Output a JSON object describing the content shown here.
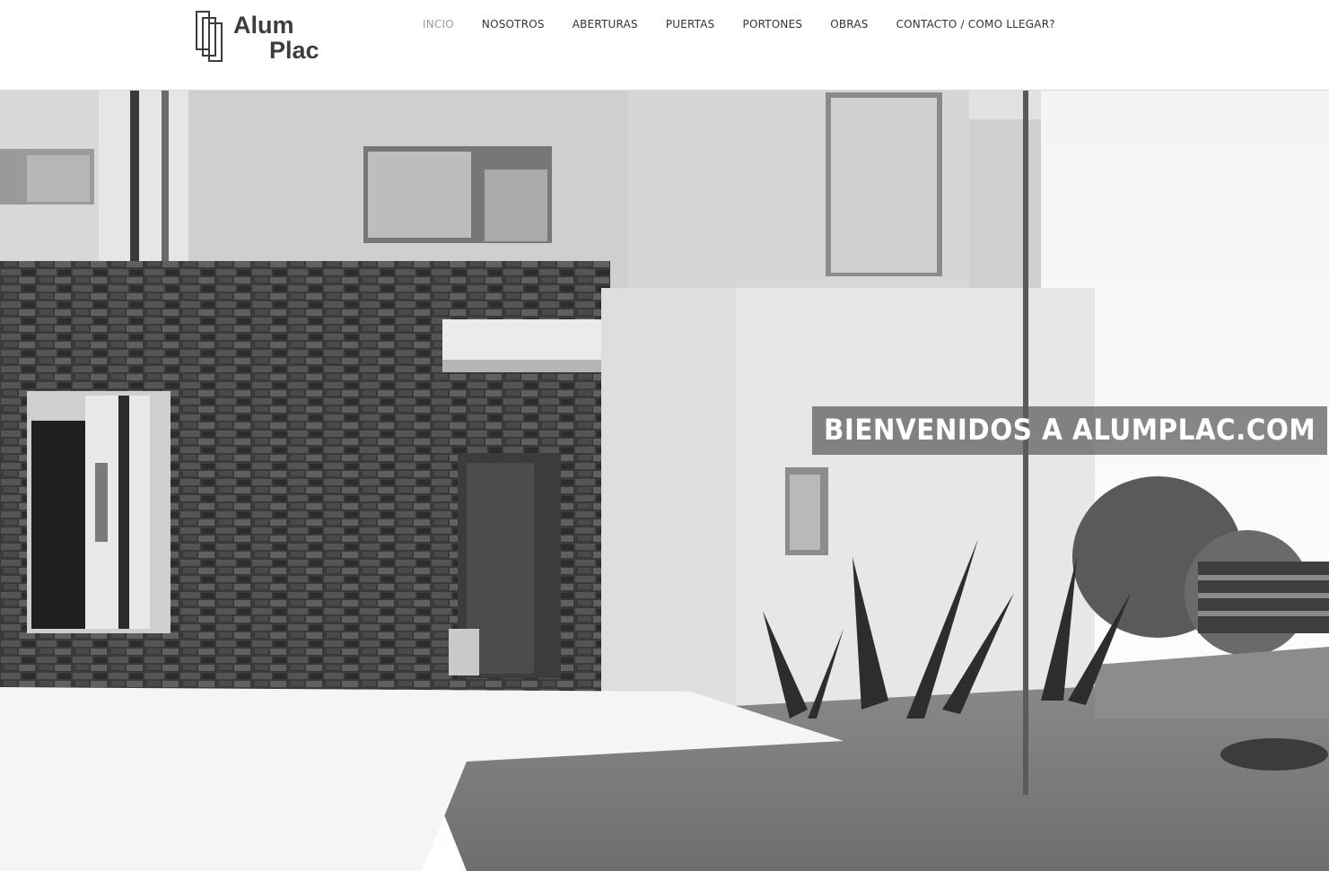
{
  "logo": {
    "line1": "Alum",
    "line2": "Plac"
  },
  "nav": [
    {
      "label": "INCIO",
      "active": true
    },
    {
      "label": "NOSOTROS"
    },
    {
      "label": "ABERTURAS"
    },
    {
      "label": "PUERTAS"
    },
    {
      "label": "PORTONES"
    },
    {
      "label": "OBRAS"
    },
    {
      "label": "CONTACTO / COMO LLEGAR?"
    }
  ],
  "hero": {
    "banner_text": "BIENVENIDOS A ALUMPLAC.COM"
  }
}
